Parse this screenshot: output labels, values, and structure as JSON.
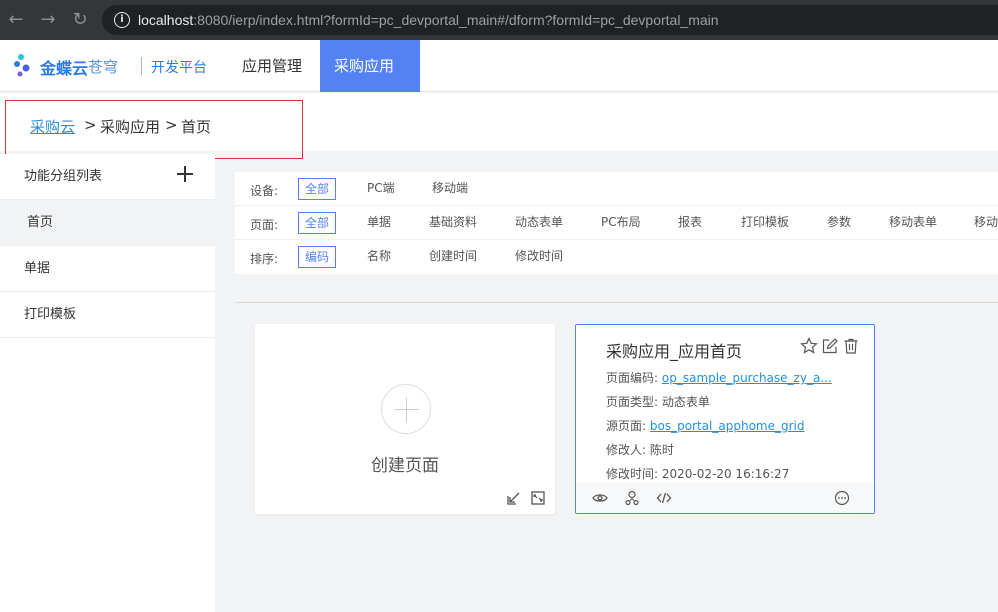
{
  "browser": {
    "url_host": "localhost",
    "url_rest": ":8080/ierp/index.html?formId=pc_devportal_main#/dform?formId=pc_devportal_main"
  },
  "header": {
    "brand": "金蝶云",
    "brand_sub": "苍穹",
    "platform": "开发平台",
    "tabs": [
      {
        "label": "应用管理",
        "active": false
      },
      {
        "label": "采购应用",
        "active": true
      }
    ],
    "accent_color": "#5582f3"
  },
  "breadcrumb": {
    "items": [
      "采购云",
      "采购应用",
      "首页"
    ],
    "separator": ">"
  },
  "sidebar": {
    "title": "功能分组列表",
    "items": [
      {
        "label": "首页",
        "active": true
      },
      {
        "label": "单据",
        "active": false
      },
      {
        "label": "打印模板",
        "active": false
      }
    ]
  },
  "filters": {
    "device": {
      "label": "设备:",
      "options": [
        "全部",
        "PC端",
        "移动端"
      ],
      "selected": "全部"
    },
    "page": {
      "label": "页面:",
      "options": [
        "全部",
        "单据",
        "基础资料",
        "动态表单",
        "PC布局",
        "报表",
        "打印模板",
        "参数",
        "移动表单",
        "移动"
      ],
      "selected": "全部"
    },
    "sort": {
      "label": "排序:",
      "options": [
        "编码",
        "名称",
        "创建时间",
        "修改时间"
      ],
      "selected": "编码"
    }
  },
  "create_card": {
    "label": "创建页面"
  },
  "page_card": {
    "title": "采购应用_应用首页",
    "code_label": "页面编码:",
    "code_value": "op_sample_purchase_zy_a...",
    "type_label": "页面类型:",
    "type_value": "动态表单",
    "source_label": "源页面:",
    "source_value": "bos_portal_apphome_grid",
    "modifier_label": "修改人:",
    "modifier_value": "陈时",
    "modified_label": "修改时间:",
    "modified_value": "2020-02-20 16:16:27"
  }
}
